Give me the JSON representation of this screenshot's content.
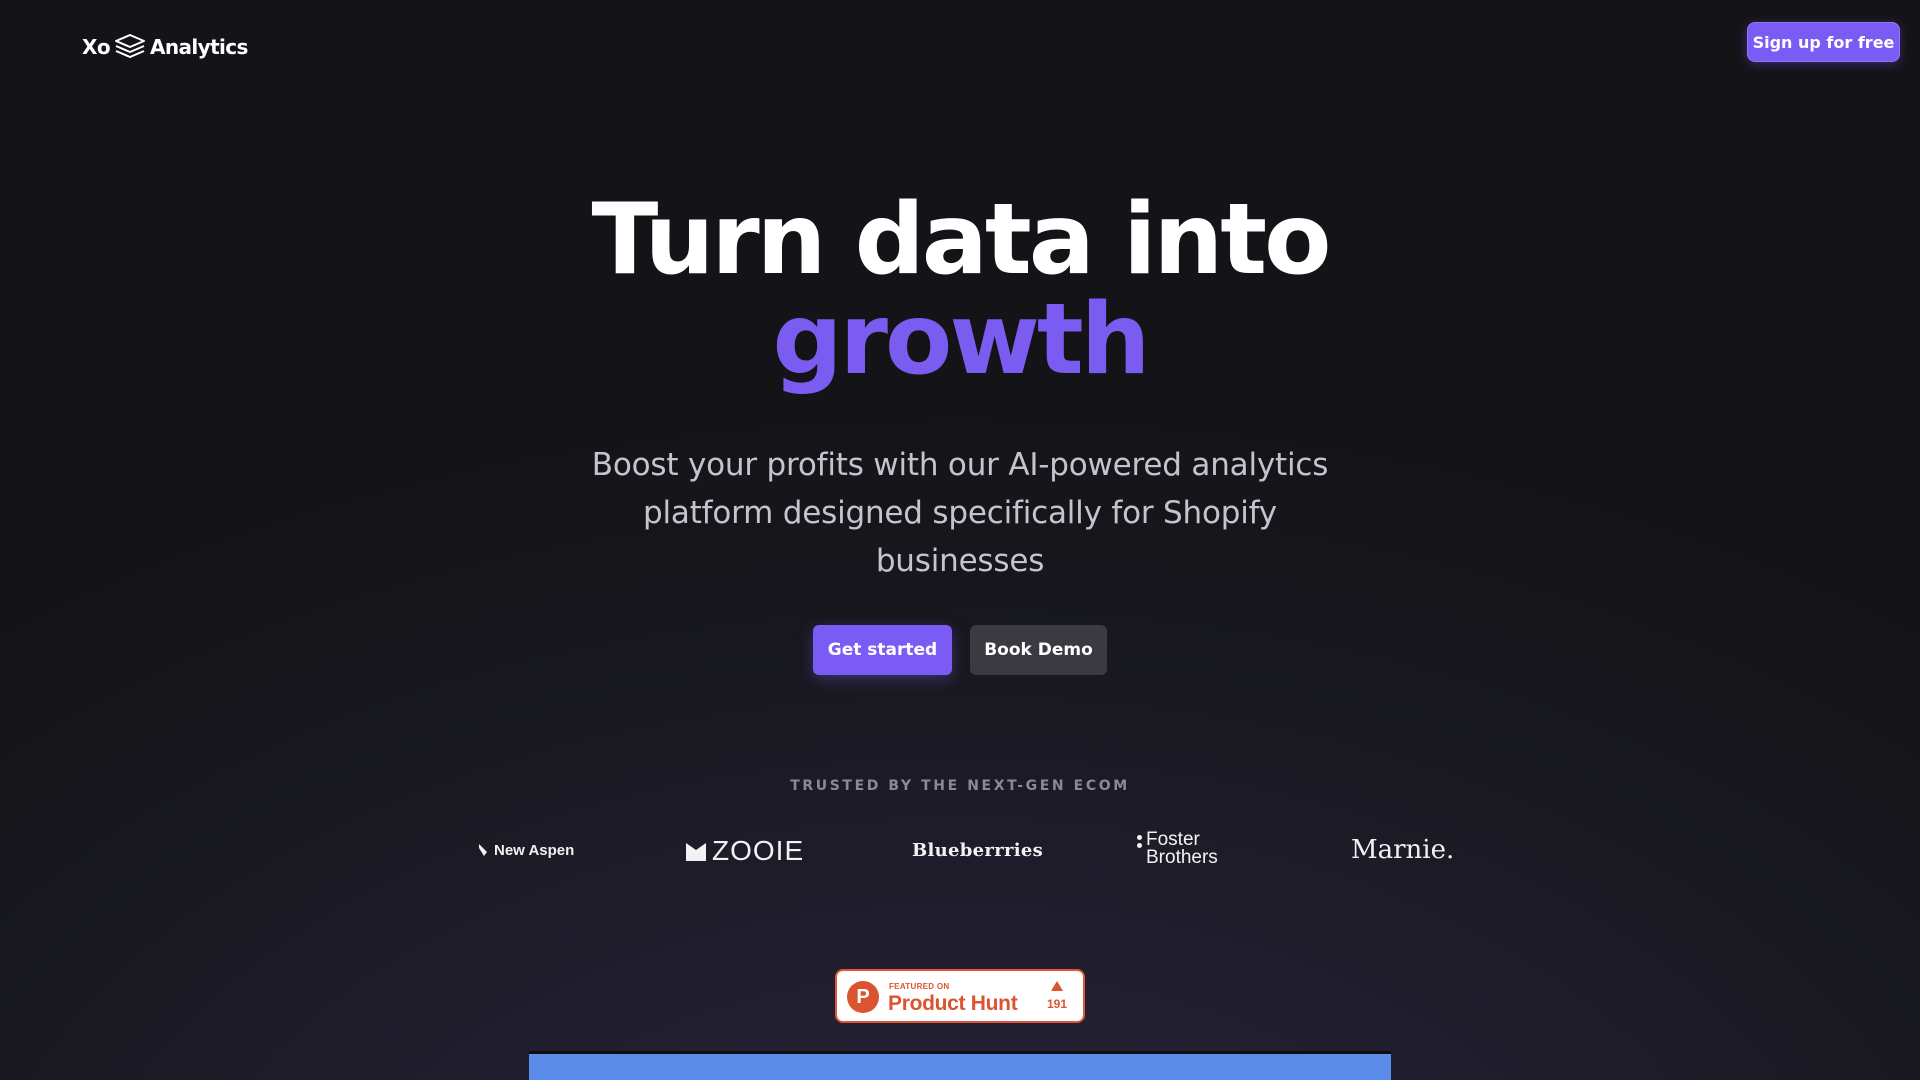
{
  "nav": {
    "logo_left": "Xo",
    "logo_right": "Analytics",
    "logo_icon": "stacked-layers-icon",
    "signup_label": "Sign up for free"
  },
  "hero": {
    "title_line1": "Turn data into",
    "title_line2": "growth",
    "subtitle": "Boost your profits with our AI-powered analytics platform designed specifically for Shopify businesses",
    "primary_cta": "Get started",
    "secondary_cta": "Book Demo"
  },
  "trusted": {
    "label": "TRUSTED BY THE NEXT-GEN ECOM",
    "brands": [
      {
        "name": "New Aspen",
        "icon": "feather-icon"
      },
      {
        "name": "ZOOIE",
        "icon": "zooie-mark-icon"
      },
      {
        "name": "Blueberrries"
      },
      {
        "name_line1": "Foster",
        "name_line2": "Brothers",
        "icon": "dots-icon"
      },
      {
        "name": "Marnie."
      }
    ]
  },
  "product_hunt": {
    "featured_label": "FEATURED ON",
    "name": "Product Hunt",
    "logo_letter": "P",
    "upvotes": "191"
  },
  "colors": {
    "accent": "#7a5cf5",
    "accent_text": "#7b5cf0",
    "background": "#141418",
    "secondary_button": "#3b3a42",
    "product_hunt": "#da552f",
    "preview_blue": "#5b8de8"
  }
}
